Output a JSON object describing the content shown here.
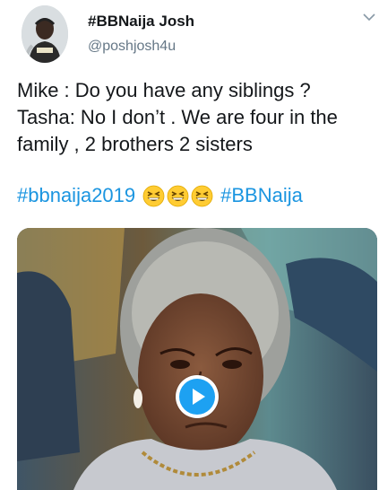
{
  "tweet": {
    "display_name": "#BBNaija Josh",
    "handle": "@poshjosh4u",
    "text_lines": [
      "Mike : Do you have any siblings ?",
      "Tasha: No I don’t . We are four in the family , 2 brothers 2 sisters"
    ],
    "hashtag_1": "#bbnaija2019",
    "hashtag_2": "#BBNaija",
    "emojis": [
      "grinning-squinting-face",
      "grinning-squinting-face",
      "grinning-squinting-face"
    ]
  },
  "icons": {
    "menu": "chevron-down-icon",
    "play": "play-icon"
  },
  "colors": {
    "link": "#1b95e0",
    "play_button": "#1da1f2",
    "handle_gray": "#657786"
  }
}
